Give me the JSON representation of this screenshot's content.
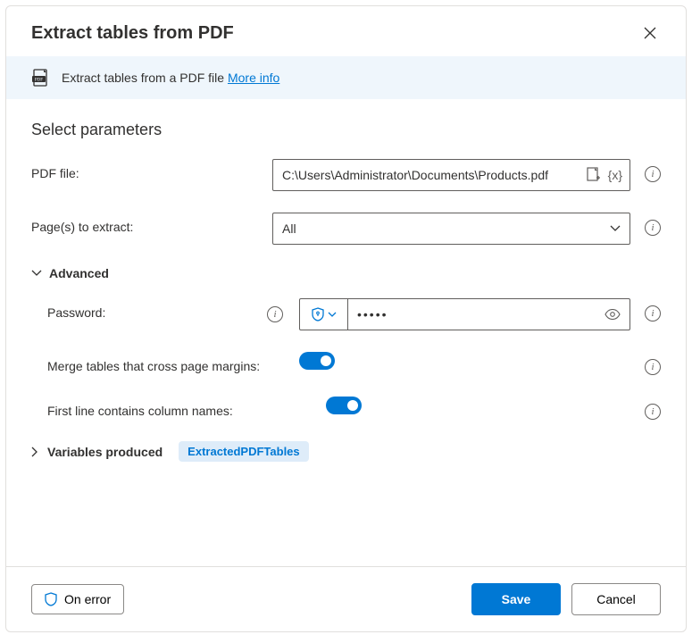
{
  "dialog": {
    "title": "Extract tables from PDF",
    "banner_text": "Extract tables from a PDF file",
    "more_info": "More info"
  },
  "section": {
    "title": "Select parameters"
  },
  "fields": {
    "pdf_file": {
      "label": "PDF file:",
      "value": "C:\\Users\\Administrator\\Documents\\Products.pdf"
    },
    "pages": {
      "label": "Page(s) to extract:",
      "value": "All"
    },
    "advanced": {
      "label": "Advanced"
    },
    "password": {
      "label": "Password:",
      "value": "•••••"
    },
    "merge": {
      "label": "Merge tables that cross page margins:"
    },
    "first_line": {
      "label": "First line contains column names:"
    },
    "variables": {
      "label": "Variables produced",
      "badge": "ExtractedPDFTables"
    }
  },
  "footer": {
    "on_error": "On error",
    "save": "Save",
    "cancel": "Cancel"
  }
}
